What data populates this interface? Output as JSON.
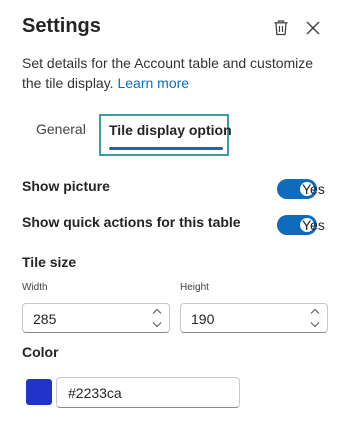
{
  "panel": {
    "title": "Settings",
    "description": "Set details for the Account table and customize the tile display.",
    "learn_more": "Learn more"
  },
  "tabs": [
    {
      "label": "General",
      "selected": false
    },
    {
      "label": "Tile display option",
      "selected": true
    }
  ],
  "options": {
    "show_picture": {
      "label": "Show picture",
      "state": "Yes",
      "on": true
    },
    "show_quick_actions": {
      "label": "Show quick actions for this table",
      "state": "Yes",
      "on": true
    }
  },
  "tile_size": {
    "heading": "Tile size",
    "width_label": "Width",
    "width_value": "285",
    "height_label": "Height",
    "height_value": "190"
  },
  "color": {
    "heading": "Color",
    "value": "#2233ca",
    "swatch": "#2233ca"
  },
  "colors": {
    "accent": "#0f6cbd",
    "focus_outline": "#3d9aa6"
  },
  "icons": {
    "trash": "trash-icon",
    "close": "close-icon",
    "stepper_up": "chevron-up-icon",
    "stepper_down": "chevron-down-icon"
  }
}
